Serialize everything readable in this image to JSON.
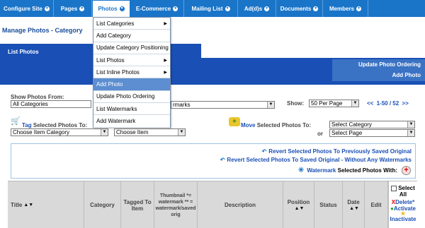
{
  "nav": [
    {
      "label": "Configure Site",
      "width": 76
    },
    {
      "label": "Pages",
      "width": 54
    },
    {
      "label": "Photos",
      "width": 54,
      "active": true
    },
    {
      "label": "E-Commerce",
      "width": 76
    },
    {
      "label": "Mailing List",
      "width": 76
    },
    {
      "label": "Ad(d)s",
      "width": 54
    },
    {
      "label": "Documents",
      "width": 66
    },
    {
      "label": "Members",
      "width": 64
    }
  ],
  "page_title": "Manage Photos - Category",
  "tab_label": "List Photos",
  "right_links": [
    "Update Photo Ordering",
    "Add Photo"
  ],
  "filters": {
    "show_from_label": "Show Photos From:",
    "show_from_value": "All Categories",
    "watermarks_suffix": "rmarks",
    "show_label": "Show:",
    "show_value": "50 Per Page",
    "pager_prev": "<<",
    "pager_text": "1-50 / 52",
    "pager_next": ">>"
  },
  "tag": {
    "label_prefix": "Tag",
    "label_rest": "Selected Photos To:",
    "category_select": "Choose Item Category",
    "item_select": "Choose Item"
  },
  "move": {
    "label_prefix": "Move",
    "label_rest": "Selected Photos To:",
    "category_select": "Select Category",
    "or": "or",
    "page_select": "Select Page"
  },
  "revert": {
    "line1": "Revert Selected Photos To Previously Saved Original",
    "line2": "Revert Selected Photos To Saved Original - Without Any Watermarks",
    "watermark_prefix": "Watermark",
    "watermark_rest": "Selected Photos With:",
    "plus": "+"
  },
  "table_headers": {
    "title": "Title",
    "category": "Category",
    "tagged": "Tagged To Item",
    "thumbnail": "Thumbnail *= watermark ** = watermark/saved orig",
    "description": "Description",
    "position": "Position",
    "status": "Status",
    "date": "Date",
    "edit": "Edit"
  },
  "actions": {
    "select_all": "Select All",
    "delete": "Delete*",
    "activate": "Activate",
    "inactivate": "Inactivate",
    "x": "X"
  },
  "sort_glyph": "▲▼",
  "menu_items": [
    {
      "label": "List Categories",
      "sub": true
    },
    {
      "label": "Add Category",
      "sub": false
    },
    {
      "label": "Update Category Positioning",
      "sub": false
    },
    {
      "label": "List Photos",
      "sub": true
    },
    {
      "label": "List Inline Photos",
      "sub": true
    },
    {
      "label": "Add Photo",
      "sub": false,
      "selected": true
    },
    {
      "label": "Update Photo Ordering",
      "sub": false
    },
    {
      "label": "List Watermarks",
      "sub": false
    },
    {
      "label": "Add Watermark",
      "sub": false
    }
  ],
  "colors": {
    "nav_blue": "#1a75c9",
    "dark_blue": "#1a4fb5",
    "menu_highlight": "#5c8ed1",
    "header_grey": "#d9d9d9"
  }
}
